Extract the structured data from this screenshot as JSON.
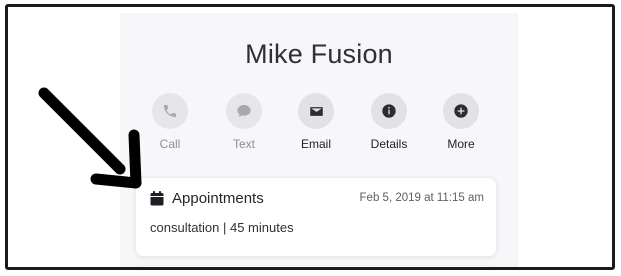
{
  "contact": {
    "name": "Mike Fusion"
  },
  "actions": [
    {
      "label": "Call",
      "icon": "phone-icon",
      "enabled": false
    },
    {
      "label": "Text",
      "icon": "chat-bubble-icon",
      "enabled": false
    },
    {
      "label": "Email",
      "icon": "envelope-icon",
      "enabled": true
    },
    {
      "label": "Details",
      "icon": "info-icon",
      "enabled": true
    },
    {
      "label": "More",
      "icon": "plus-icon",
      "enabled": true
    }
  ],
  "appointment": {
    "title": "Appointments",
    "date": "Feb 5, 2019 at 11:15 am",
    "details": "consultation | 45 minutes",
    "icon": "calendar-icon"
  },
  "colors": {
    "frame": "#1a1a1a",
    "panel": "#f7f7f9",
    "action_circle": "#e2e2e6",
    "icon_active": "#2b2b33",
    "icon_inactive": "#a8a8b0",
    "annotation_arrow": "#000000"
  }
}
